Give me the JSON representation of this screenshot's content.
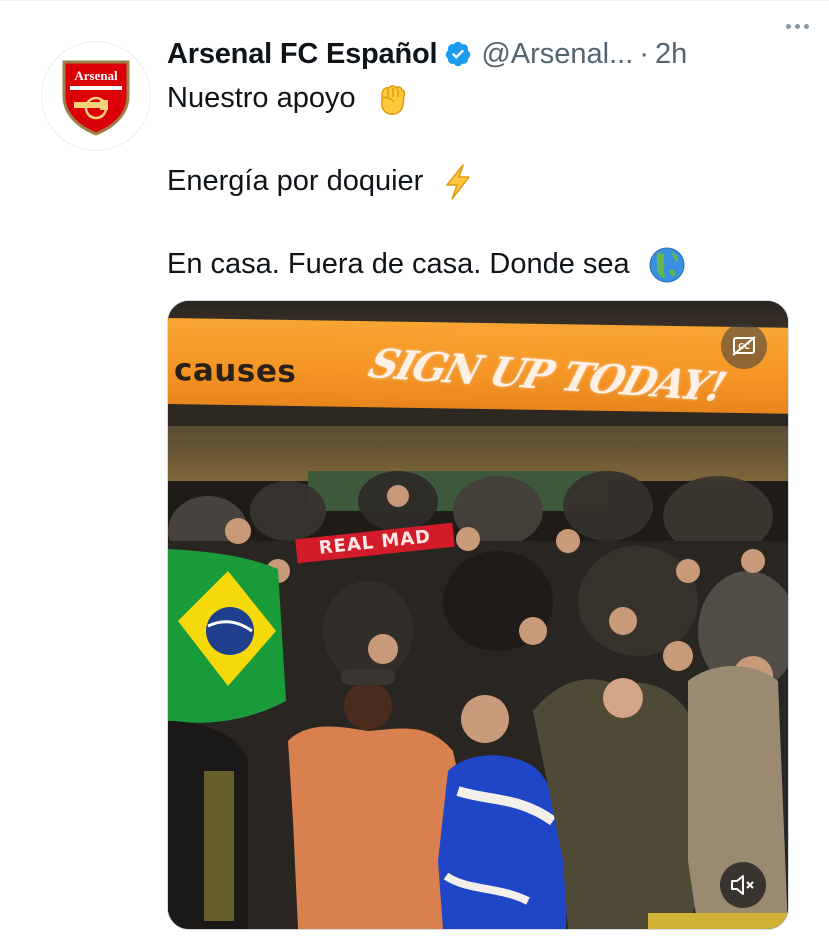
{
  "tweet": {
    "display_name": "Arsenal FC Español",
    "handle": "@Arsenal...",
    "separator": "·",
    "time": "2h",
    "avatar_text": "Arsenal",
    "lines": [
      "Nuestro apoyo",
      "Energía por doquier",
      "En casa. Fuera de casa. Donde sea"
    ],
    "emojis": [
      "raised-fist-emoji",
      "lightning-emoji",
      "globe-americas-emoji"
    ]
  },
  "media": {
    "banner_left": "causes",
    "banner_right": "SIGN UP TODAY!",
    "scarf_text": "REAL MAD",
    "cc_icon": "captions-off-icon",
    "mute_icon": "muted-speaker-icon"
  },
  "colors": {
    "verified_blue": "#1d9bf0",
    "banner_orange": "#f59626",
    "arsenal_red": "#db0007",
    "secondary_text": "#536471"
  }
}
